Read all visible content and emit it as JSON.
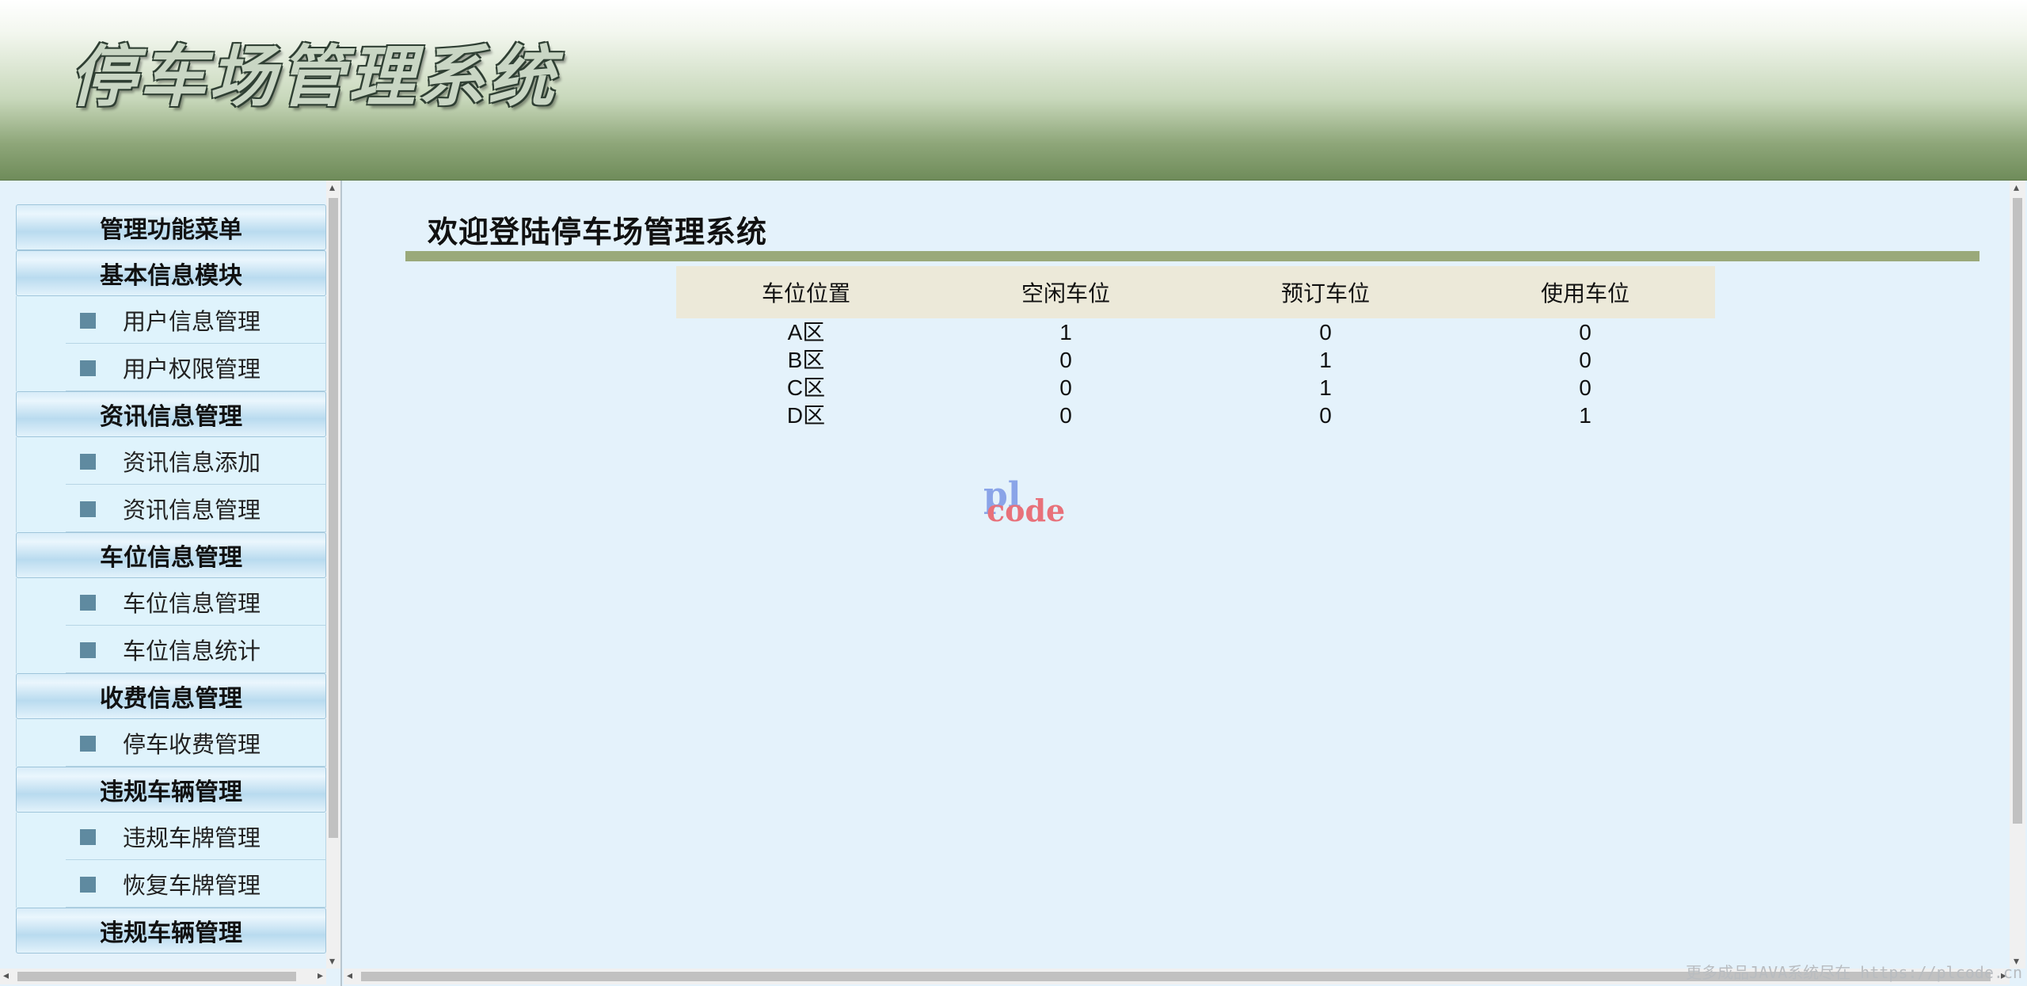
{
  "header": {
    "title": "停车场管理系统"
  },
  "sidebar": {
    "sections": [
      {
        "label": "管理功能菜单",
        "items": []
      },
      {
        "label": "基本信息模块",
        "items": [
          "用户信息管理",
          "用户权限管理"
        ]
      },
      {
        "label": "资讯信息管理",
        "items": [
          "资讯信息添加",
          "资讯信息管理"
        ]
      },
      {
        "label": "车位信息管理",
        "items": [
          "车位信息管理",
          "车位信息统计"
        ]
      },
      {
        "label": "收费信息管理",
        "items": [
          "停车收费管理"
        ]
      },
      {
        "label": "违规车辆管理",
        "items": [
          "违规车牌管理",
          "恢复车牌管理"
        ]
      },
      {
        "label": "违规车辆管理",
        "items": []
      }
    ]
  },
  "main": {
    "welcome": "欢迎登陆停车场管理系统",
    "table": {
      "headers": [
        "车位位置",
        "空闲车位",
        "预订车位",
        "使用车位"
      ],
      "rows": [
        [
          "A区",
          "1",
          "0",
          "0"
        ],
        [
          "B区",
          "0",
          "1",
          "0"
        ],
        [
          "C区",
          "0",
          "1",
          "0"
        ],
        [
          "D区",
          "0",
          "0",
          "1"
        ]
      ]
    },
    "logo": {
      "pl": "pl",
      "code": "code"
    }
  },
  "footer": {
    "watermark": "更多成品JAVA系统尽在 https://plcode.cn"
  },
  "colors": {
    "header_green": "#6f8c5a",
    "page_bg": "#e4f2fb",
    "accent_bar": "#9aa97a",
    "table_header_bg": "#ece9d9"
  }
}
